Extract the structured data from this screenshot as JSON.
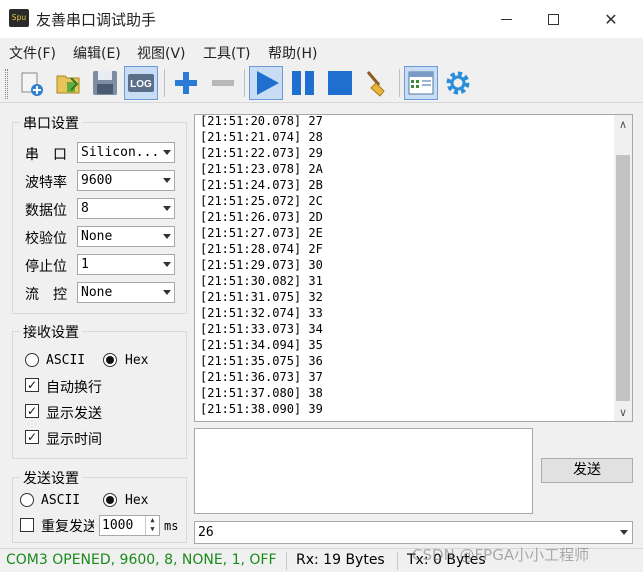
{
  "window": {
    "title": "友善串口调试助手",
    "app_icon_text": "Spu",
    "minimize_icon": "minimize-icon",
    "maximize_icon": "maximize-icon",
    "close_icon": "close-icon",
    "close_glyph": "✕"
  },
  "menu": [
    "文件(F)",
    "编辑(E)",
    "视图(V)",
    "工具(T)",
    "帮助(H)"
  ],
  "toolbar": {
    "icons": [
      "new-session-icon",
      "open-folder-icon",
      "save-icon",
      "log-icon",
      "add-icon",
      "remove-icon",
      "play-icon",
      "pause-icon",
      "stop-icon",
      "clear-broom-icon",
      "window-layout-icon",
      "settings-gear-icon"
    ],
    "log_label": "LOG"
  },
  "serial_settings": {
    "title": "串口设置",
    "port_label": "串　口",
    "port_value": "Silicon...",
    "baud_label": "波特率",
    "baud_value": "9600",
    "databits_label": "数据位",
    "databits_value": "8",
    "parity_label": "校验位",
    "parity_value": "None",
    "stopbits_label": "停止位",
    "stopbits_value": "1",
    "flow_label": "流　控",
    "flow_value": "None"
  },
  "receive_settings": {
    "title": "接收设置",
    "ascii_label": "ASCII",
    "hex_label": "Hex",
    "mode": "Hex",
    "auto_wrap_label": "自动换行",
    "auto_wrap": true,
    "show_send_label": "显示发送",
    "show_send": true,
    "show_time_label": "显示时间",
    "show_time": true
  },
  "send_settings": {
    "title": "发送设置",
    "ascii_label": "ASCII",
    "hex_label": "Hex",
    "mode": "Hex",
    "repeat_label": "重复发送",
    "repeat": false,
    "interval_value": "1000",
    "interval_unit": "ms"
  },
  "receive_log": [
    "[21:51:20.078] 27",
    "[21:51:21.074] 28",
    "[21:51:22.073] 29",
    "[21:51:23.078] 2A",
    "[21:51:24.073] 2B",
    "[21:51:25.072] 2C",
    "[21:51:26.073] 2D",
    "[21:51:27.073] 2E",
    "[21:51:28.074] 2F",
    "[21:51:29.073] 30",
    "[21:51:30.082] 31",
    "[21:51:31.075] 32",
    "[21:51:32.074] 33",
    "[21:51:33.073] 34",
    "[21:51:34.094] 35",
    "[21:51:35.075] 36",
    "[21:51:36.073] 37",
    "[21:51:37.080] 38",
    "[21:51:38.090] 39"
  ],
  "send": {
    "text": "",
    "button_label": "发送",
    "history_value": "26"
  },
  "status": {
    "connection": "COM3 OPENED, 9600, 8, NONE, 1, OFF",
    "connection_color": "#1a8a1a",
    "rx": "Rx: 19 Bytes",
    "tx": "Tx: 0 Bytes"
  },
  "watermark": "CSDN @FPGA小小工程师"
}
